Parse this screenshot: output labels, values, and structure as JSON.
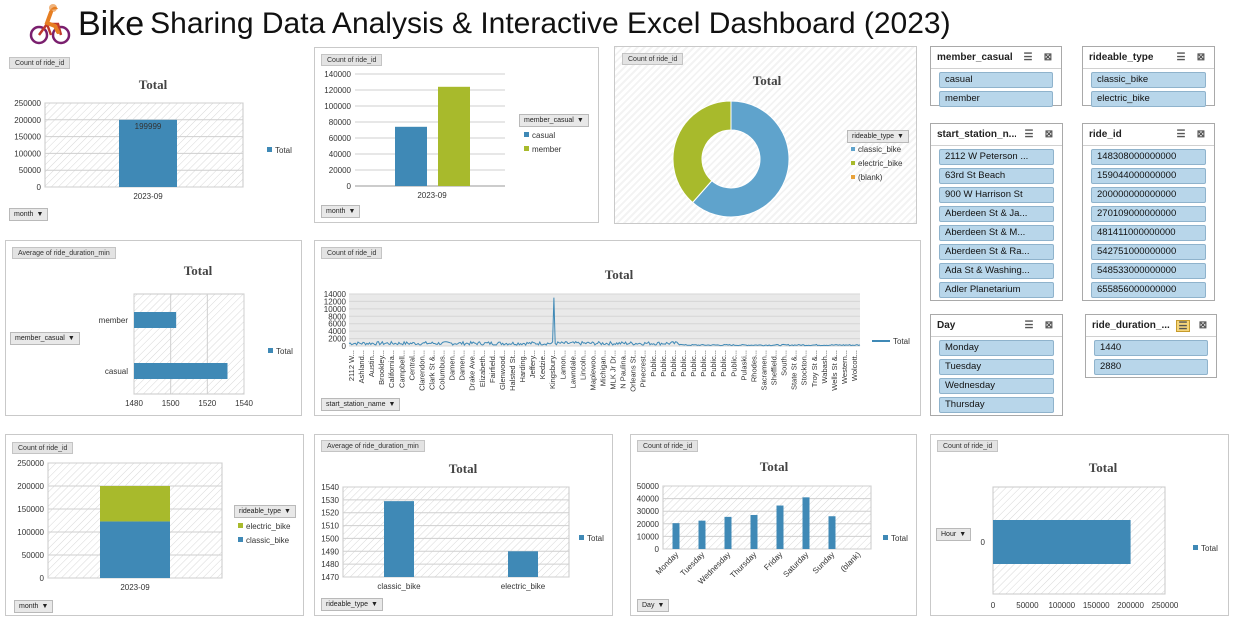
{
  "header": {
    "title_main": "Bike",
    "title_rest": "Sharing Data Analysis & Interactive Excel Dashboard (2023)"
  },
  "colors": {
    "blue": "#3f89b6",
    "green": "#a8ba2c",
    "donut_blue": "#5fa3cc",
    "slicer_item": "#b8d6ea"
  },
  "charts": {
    "c1": {
      "field": "Count of ride_id",
      "title": "Total",
      "legend": "Total",
      "filter": "month",
      "chart_data": {
        "type": "bar",
        "title": "Total",
        "categories": [
          "2023-09"
        ],
        "values": [
          199999
        ],
        "ylim": [
          0,
          250000
        ],
        "yticks": [
          0,
          50000,
          100000,
          150000,
          200000,
          250000
        ],
        "data_label": "199999",
        "legend": [
          "Total"
        ]
      }
    },
    "c2": {
      "field": "Count of ride_id",
      "filter": "month",
      "legend_title": "member_casual",
      "chart_data": {
        "type": "bar",
        "categories": [
          "2023-09"
        ],
        "series": [
          {
            "name": "casual",
            "values": [
              74000
            ]
          },
          {
            "name": "member",
            "values": [
              124000
            ]
          }
        ],
        "ylim": [
          0,
          140000
        ],
        "yticks": [
          0,
          20000,
          40000,
          60000,
          80000,
          100000,
          120000,
          140000
        ]
      }
    },
    "c3": {
      "field": "Count of ride_id",
      "title": "Total",
      "legend_title": "rideable_type",
      "chart_data": {
        "type": "pie",
        "title": "Total",
        "slices": [
          {
            "name": "classic_bike",
            "value": 61.5
          },
          {
            "name": "electric_bike",
            "value": 38.5
          },
          {
            "name": "(blank)",
            "value": 0
          }
        ]
      }
    },
    "c4": {
      "field": "Average of ride_duration_min",
      "title": "Total",
      "legend": "Total",
      "filter": "member_casual",
      "chart_data": {
        "type": "bar",
        "orientation": "horizontal",
        "title": "Total",
        "categories": [
          "member",
          "casual"
        ],
        "values": [
          1503,
          1531
        ],
        "xlim": [
          1480,
          1540
        ],
        "xticks": [
          1480,
          1500,
          1520,
          1540
        ],
        "legend": [
          "Total"
        ]
      }
    },
    "c5": {
      "field": "Count of ride_id",
      "title": "Total",
      "legend": "Total",
      "filter": "start_station_name",
      "chart_data": {
        "type": "line",
        "title": "Total",
        "ylim": [
          0,
          14000
        ],
        "yticks": [
          0,
          2000,
          4000,
          6000,
          8000,
          10000,
          12000,
          14000
        ],
        "legend": [
          "Total"
        ],
        "xlabels": [
          "2112 W...",
          "Ashland...",
          "Austin...",
          "Brookley...",
          "California...",
          "Campbell...",
          "Central...",
          "Clarendon...",
          "Clark St &...",
          "Columbus...",
          "Damen...",
          "Damen...",
          "Drake Ave...",
          "Elizabeth...",
          "Fairfield...",
          "Glenwood...",
          "Halsted St...",
          "Harding...",
          "Jeffery...",
          "Kedzie...",
          "Kingsbury...",
          "Lamon...",
          "Lawndale...",
          "Lincoln...",
          "Maplewoo...",
          "Michigan...",
          "MLK Jr Dr...",
          "N Paulina...",
          "Orleans St...",
          "Pinecrest...",
          "Public...",
          "Public...",
          "Public...",
          "Public...",
          "Public...",
          "Public...",
          "Public...",
          "Public...",
          "Public...",
          "Pulaski...",
          "Rhodes...",
          "Sacramen...",
          "Sheffield...",
          "South...",
          "State St &...",
          "Stockton...",
          "Troy St &...",
          "Wabash...",
          "Wells St &...",
          "Western...",
          "Wolcott..."
        ],
        "peak_value": 13000,
        "baseline_level": 800
      }
    },
    "c6": {
      "field": "Count of ride_id",
      "filter": "month",
      "legend_title": "rideable_type",
      "chart_data": {
        "type": "bar",
        "stacked": true,
        "categories": [
          "2023-09"
        ],
        "series": [
          {
            "name": "electric_bike",
            "values": [
              77000
            ]
          },
          {
            "name": "classic_bike",
            "values": [
              123000
            ]
          }
        ],
        "ylim": [
          0,
          250000
        ],
        "yticks": [
          0,
          50000,
          100000,
          150000,
          200000,
          250000
        ]
      }
    },
    "c7": {
      "field": "Average of ride_duration_min",
      "title": "Total",
      "legend": "Total",
      "filter": "rideable_type",
      "chart_data": {
        "type": "bar",
        "title": "Total",
        "categories": [
          "classic_bike",
          "electric_bike"
        ],
        "values": [
          1529,
          1490
        ],
        "ylim": [
          1470,
          1540
        ],
        "yticks": [
          1470,
          1480,
          1490,
          1500,
          1510,
          1520,
          1530,
          1540
        ],
        "legend": [
          "Total"
        ]
      }
    },
    "c8": {
      "field": "Count of ride_id",
      "title": "Total",
      "legend": "Total",
      "filter": "Day",
      "chart_data": {
        "type": "bar",
        "title": "Total",
        "categories": [
          "Monday",
          "Tuesday",
          "Wednesday",
          "Thursday",
          "Friday",
          "Saturday",
          "Sunday",
          "(blank)"
        ],
        "values": [
          20500,
          22500,
          25500,
          27000,
          34500,
          41000,
          26000,
          0
        ],
        "ylim": [
          0,
          50000
        ],
        "yticks": [
          0,
          10000,
          20000,
          30000,
          40000,
          50000
        ],
        "legend": [
          "Total"
        ]
      }
    },
    "c9": {
      "field": "Count of ride_id",
      "title": "Total",
      "legend": "Total",
      "filter": "Hour",
      "chart_data": {
        "type": "bar",
        "orientation": "horizontal",
        "title": "Total",
        "categories": [
          "0"
        ],
        "values": [
          200000
        ],
        "xlim": [
          0,
          250000
        ],
        "xticks": [
          0,
          50000,
          100000,
          150000,
          200000,
          250000
        ],
        "legend": [
          "Total"
        ]
      }
    }
  },
  "slicers": {
    "member_casual": {
      "title": "member_casual",
      "items": [
        "casual",
        "member"
      ]
    },
    "rideable_type": {
      "title": "rideable_type",
      "items": [
        "classic_bike",
        "electric_bike"
      ]
    },
    "start_station": {
      "title": "start_station_n...",
      "items": [
        "2112 W Peterson ...",
        "63rd St Beach",
        "900 W Harrison St",
        "Aberdeen St & Ja...",
        "Aberdeen St & M...",
        "Aberdeen St & Ra...",
        "Ada St & Washing...",
        "Adler Planetarium"
      ]
    },
    "ride_id": {
      "title": "ride_id",
      "items": [
        "148308000000000",
        "159044000000000",
        "200000000000000",
        "270109000000000",
        "481411000000000",
        "542751000000000",
        "548533000000000",
        "655856000000000"
      ]
    },
    "day": {
      "title": "Day",
      "items": [
        "Monday",
        "Tuesday",
        "Wednesday",
        "Thursday"
      ]
    },
    "ride_duration": {
      "title": "ride_duration_...",
      "items": [
        "1440",
        "2880"
      ]
    }
  }
}
